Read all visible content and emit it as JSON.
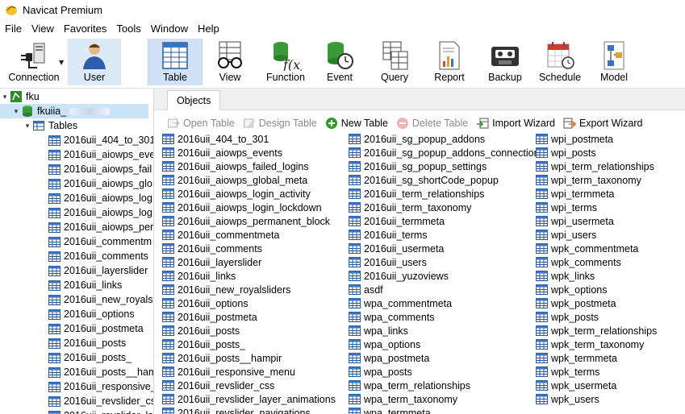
{
  "window": {
    "title": "Navicat Premium"
  },
  "menu": [
    "File",
    "View",
    "Favorites",
    "Tools",
    "Window",
    "Help"
  ],
  "toolbar": {
    "connection": "Connection",
    "user": "User",
    "table": "Table",
    "view": "View",
    "function": "Function",
    "event": "Event",
    "query": "Query",
    "report": "Report",
    "backup": "Backup",
    "schedule": "Schedule",
    "model": "Model"
  },
  "sidebar": {
    "connection": "fku",
    "database": "fkuiia_",
    "tables_label": "Tables",
    "tables": [
      "2016uii_404_to_301",
      "2016uii_aiowps_eve",
      "2016uii_aiowps_fail",
      "2016uii_aiowps_glo",
      "2016uii_aiowps_log",
      "2016uii_aiowps_log",
      "2016uii_aiowps_per",
      "2016uii_commentm",
      "2016uii_comments",
      "2016uii_layerslider",
      "2016uii_links",
      "2016uii_new_royals",
      "2016uii_options",
      "2016uii_postmeta",
      "2016uii_posts",
      "2016uii_posts_",
      "2016uii_posts__ham",
      "2016uii_responsive_",
      "2016uii_revslider_cs",
      "2016uii_revslider_la"
    ]
  },
  "tabs": {
    "objects": "Objects"
  },
  "objbar": {
    "open_table": "Open Table",
    "design_table": "Design Table",
    "new_table": "New Table",
    "delete_table": "Delete Table",
    "import_wizard": "Import Wizard",
    "export_wizard": "Export Wizard"
  },
  "objects": {
    "col1": [
      "2016uii_404_to_301",
      "2016uii_aiowps_events",
      "2016uii_aiowps_failed_logins",
      "2016uii_aiowps_global_meta",
      "2016uii_aiowps_login_activity",
      "2016uii_aiowps_login_lockdown",
      "2016uii_aiowps_permanent_block",
      "2016uii_commentmeta",
      "2016uii_comments",
      "2016uii_layerslider",
      "2016uii_links",
      "2016uii_new_royalsliders",
      "2016uii_options",
      "2016uii_postmeta",
      "2016uii_posts",
      "2016uii_posts_",
      "2016uii_posts__hampir",
      "2016uii_responsive_menu",
      "2016uii_revslider_css",
      "2016uii_revslider_layer_animations",
      "2016uii_revslider_navigations"
    ],
    "col2": [
      "2016uii_sg_popup_addons",
      "2016uii_sg_popup_addons_connection",
      "2016uii_sg_popup_settings",
      "2016uii_sg_shortCode_popup",
      "2016uii_term_relationships",
      "2016uii_term_taxonomy",
      "2016uii_termmeta",
      "2016uii_terms",
      "2016uii_usermeta",
      "2016uii_users",
      "2016uii_yuzoviews",
      "asdf",
      "wpa_commentmeta",
      "wpa_comments",
      "wpa_links",
      "wpa_options",
      "wpa_postmeta",
      "wpa_posts",
      "wpa_term_relationships",
      "wpa_term_taxonomy",
      "wpa_termmeta"
    ],
    "col3": [
      "wpi_postmeta",
      "wpi_posts",
      "wpi_term_relationships",
      "wpi_term_taxonomy",
      "wpi_termmeta",
      "wpi_terms",
      "wpi_usermeta",
      "wpi_users",
      "wpk_commentmeta",
      "wpk_comments",
      "wpk_links",
      "wpk_options",
      "wpk_postmeta",
      "wpk_posts",
      "wpk_term_relationships",
      "wpk_term_taxonomy",
      "wpk_termmeta",
      "wpk_terms",
      "wpk_usermeta",
      "wpk_users"
    ]
  },
  "colors": {
    "accent": "#cfe2f6",
    "selected_row": "#cce4f7"
  }
}
